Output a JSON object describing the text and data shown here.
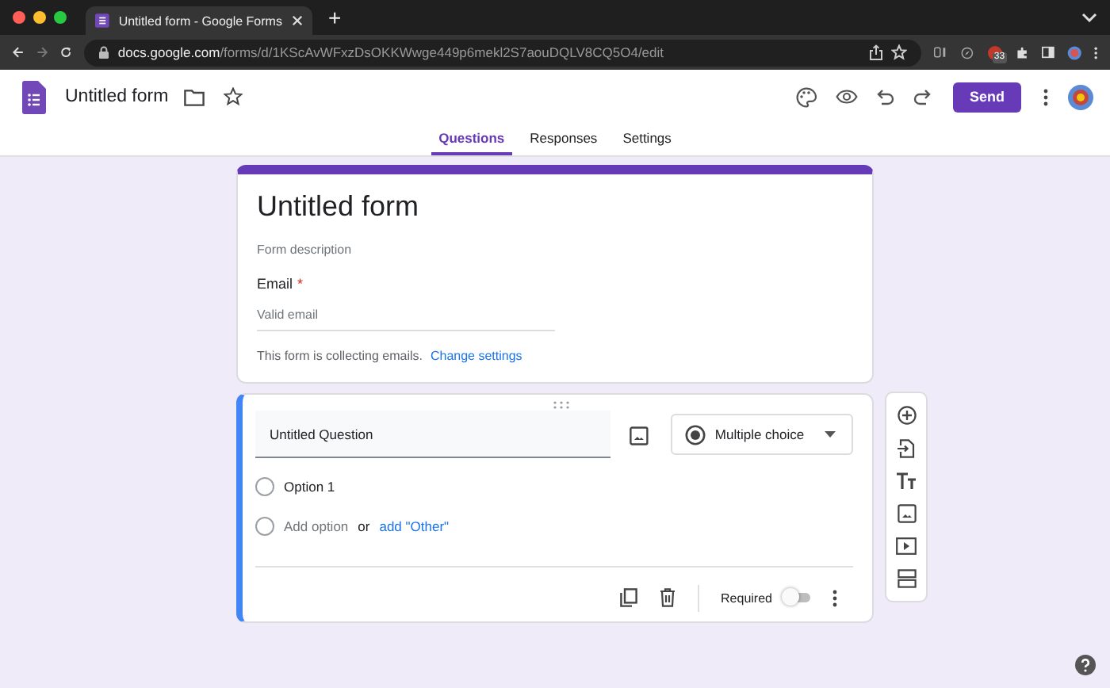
{
  "browser": {
    "tab_title": "Untitled form - Google Forms",
    "new_tab": "+",
    "url_host": "docs.google.com",
    "url_path": "/forms/d/1KScAvWFxzDsOKKWwge449p6mekl2S7aouDQLV8CQ5O4/edit",
    "extension_badge": "33"
  },
  "header": {
    "title": "Untitled form",
    "send": "Send"
  },
  "tabs": [
    {
      "label": "Questions",
      "selected": true
    },
    {
      "label": "Responses",
      "selected": false
    },
    {
      "label": "Settings",
      "selected": false
    }
  ],
  "form_header": {
    "title": "Untitled form",
    "description_placeholder": "Form description",
    "email_label": "Email",
    "email_required_mark": "*",
    "email_placeholder": "Valid email",
    "note": "This form is collecting emails.",
    "note_link": "Change settings"
  },
  "question": {
    "title": "Untitled Question",
    "type": "Multiple choice",
    "options": [
      {
        "label": "Option 1",
        "selected": false
      }
    ],
    "add_option": "Add option",
    "or": "or",
    "add_other": "add \"Other\"",
    "required_label": "Required",
    "required": false
  }
}
